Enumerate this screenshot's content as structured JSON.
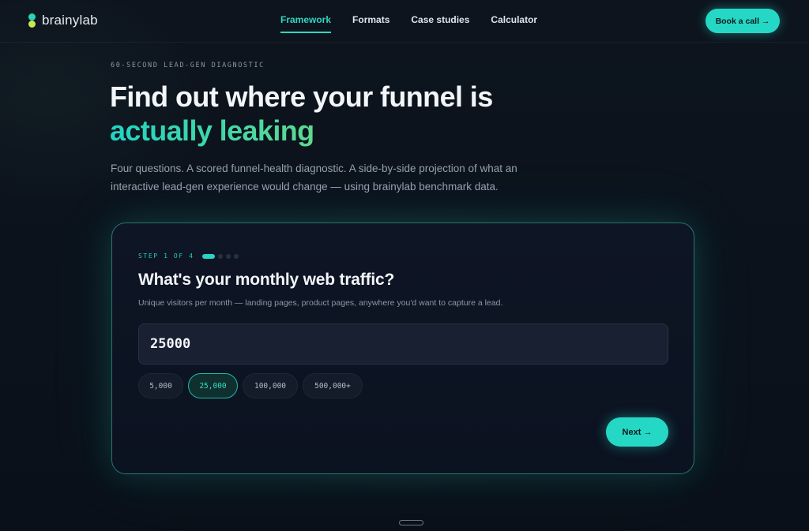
{
  "header": {
    "brand": "brainylab",
    "nav": [
      "Framework",
      "Formats",
      "Case studies",
      "Calculator"
    ],
    "active_nav": "Framework",
    "cta_label": "Book a call →"
  },
  "hero": {
    "eyebrow": "60-SECOND LEAD-GEN DIAGNOSTIC",
    "title_line1": "Find out where your funnel is",
    "title_line2": "actually leaking",
    "lede": "Four questions. A scored funnel-health diagnostic. A side-by-side projection of what an interactive lead-gen experience would change — using brainylab benchmark data."
  },
  "card": {
    "step_label": "STEP 1 OF 4",
    "current_step": 1,
    "total_steps": 4,
    "question": "What's your monthly web traffic?",
    "help_text": "Unique visitors per month — landing pages, product pages, anywhere you'd want to capture a lead.",
    "input_value": "25000",
    "presets": [
      "5,000",
      "25,000",
      "100,000",
      "500,000+"
    ],
    "selected_preset": "25,000",
    "next_label": "Next →"
  },
  "colors": {
    "accent": "#25d8c5",
    "accent_alt": "#c6ea4f",
    "background": "#0b111b"
  }
}
